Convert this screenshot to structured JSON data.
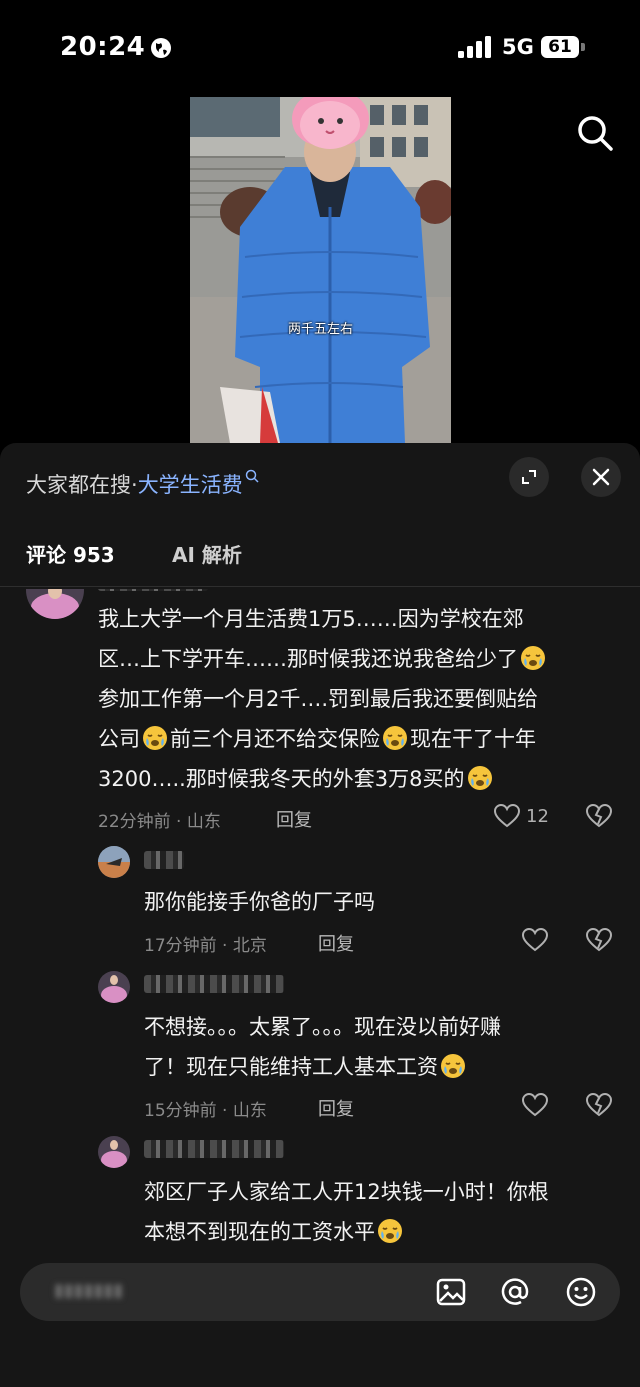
{
  "status": {
    "time": "20:24",
    "network": "5G",
    "battery": "61"
  },
  "video": {
    "caption": "两千五左右"
  },
  "sheet": {
    "trend_prefix": "大家都在搜·",
    "trend_keyword": "大学生活费",
    "tabs": [
      {
        "label": "评论 953"
      },
      {
        "label": "AI 解析"
      }
    ]
  },
  "comments": [
    {
      "lines": [
        "我上大学一个月生活费1万5……因为学校在郊",
        "区…上下学开车……那时候我还说我爸给少了",
        "参加工作第一个月2千….罚到最后我还要倒贴给",
        "公司",
        "前三个月还不给交保险",
        "现在干了十年",
        "3200…..那时候我冬天的外套3万8买的"
      ],
      "time": "22分钟前",
      "location": "山东",
      "reply": "回复",
      "likes": "12"
    },
    {
      "text": "那你能接手你爸的厂子吗",
      "time": "17分钟前",
      "location": "北京",
      "reply": "回复"
    },
    {
      "lines": [
        "不想接。。。太累了。。。现在没以前好赚",
        "了！现在只能维持工人基本工资"
      ],
      "time": "15分钟前",
      "location": "山东",
      "reply": "回复"
    },
    {
      "lines": [
        "郊区厂子人家给工人开12块钱一小时！你根",
        "本想不到现在的工资水平"
      ]
    }
  ],
  "colors": {
    "sheet_bg": "#161616",
    "keyword": "#8ab4ff",
    "meta": "#8a8a8a",
    "coat_blue": "#3f7fd6"
  },
  "icons": {
    "emoji": "crying-face-emoji",
    "like": "heart-outline-icon",
    "dislike": "broken-heart-icon"
  }
}
